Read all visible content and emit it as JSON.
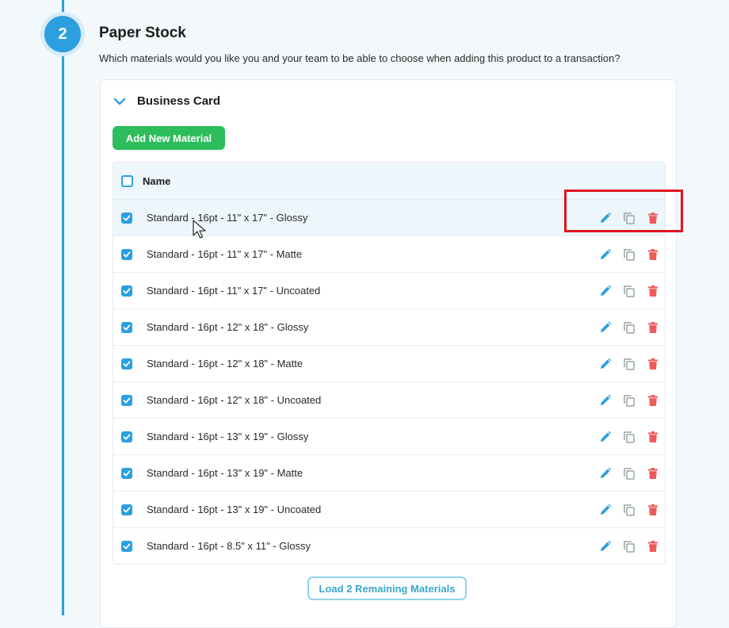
{
  "step": {
    "number": "2"
  },
  "section": {
    "title": "Paper Stock",
    "subtitle": "Which materials would you like you and your team to be able to choose when adding this product to a transaction?"
  },
  "card": {
    "title": "Business Card",
    "add_button_label": "Add New Material",
    "load_more_label": "Load 2 Remaining Materials"
  },
  "table": {
    "header_name": "Name",
    "rows": [
      {
        "label": "Standard - 16pt - 11\" x 17\" - Glossy",
        "checked": true
      },
      {
        "label": "Standard - 16pt - 11\" x 17\" - Matte",
        "checked": true
      },
      {
        "label": "Standard - 16pt - 11\" x 17\" - Uncoated",
        "checked": true
      },
      {
        "label": "Standard - 16pt - 12\" x 18\" - Glossy",
        "checked": true
      },
      {
        "label": "Standard - 16pt - 12\" x 18\" - Matte",
        "checked": true
      },
      {
        "label": "Standard - 16pt - 12\" x 18\" - Uncoated",
        "checked": true
      },
      {
        "label": "Standard - 16pt - 13\" x 19\" - Glossy",
        "checked": true
      },
      {
        "label": "Standard - 16pt - 13\" x 19\" - Matte",
        "checked": true
      },
      {
        "label": "Standard - 16pt - 13\" x 19\" - Uncoated",
        "checked": true
      },
      {
        "label": "Standard - 16pt - 8.5\" x 11\" - Glossy",
        "checked": true
      }
    ]
  },
  "icons": {
    "edit": "pencil-icon",
    "duplicate": "copy-icon",
    "delete": "trash-icon",
    "collapse": "chevron-down-icon"
  },
  "colors": {
    "accent": "#2c9fe0",
    "add_button": "#2dbd5c",
    "delete": "#ee5a5a",
    "highlight": "#e0141e"
  }
}
